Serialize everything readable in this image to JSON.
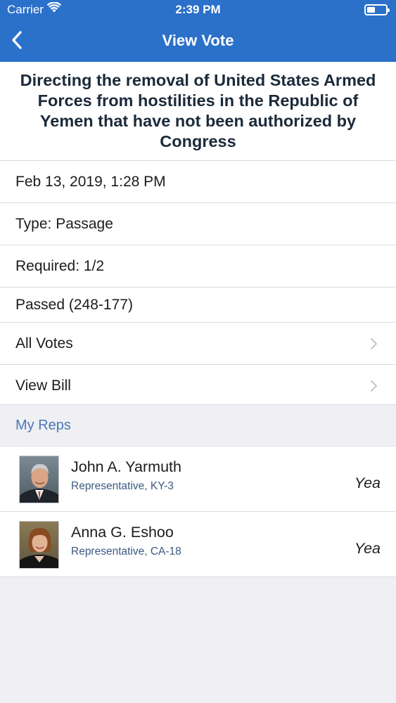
{
  "status_bar": {
    "carrier": "Carrier",
    "time": "2:39 PM",
    "battery_level": 0.45
  },
  "nav": {
    "title": "View Vote",
    "back_icon": "chevron-left-icon"
  },
  "vote": {
    "title": "Directing the removal of United States Armed Forces from hostilities in the Republic of Yemen that have not been authorized by Congress",
    "date": "Feb 13, 2019, 1:28 PM",
    "type": "Type: Passage",
    "required": "Required: 1/2",
    "result": "Passed (248-177)",
    "all_votes_label": "All Votes",
    "view_bill_label": "View Bill"
  },
  "my_reps": {
    "header": "My Reps",
    "reps": [
      {
        "name": "John A. Yarmuth",
        "role": "Representative, KY-3",
        "vote": "Yea"
      },
      {
        "name": "Anna G. Eshoo",
        "role": "Representative, CA-18",
        "vote": "Yea"
      }
    ]
  },
  "colors": {
    "accent": "#2b70c9",
    "section_text": "#4a78b4",
    "background": "#efeff4"
  }
}
